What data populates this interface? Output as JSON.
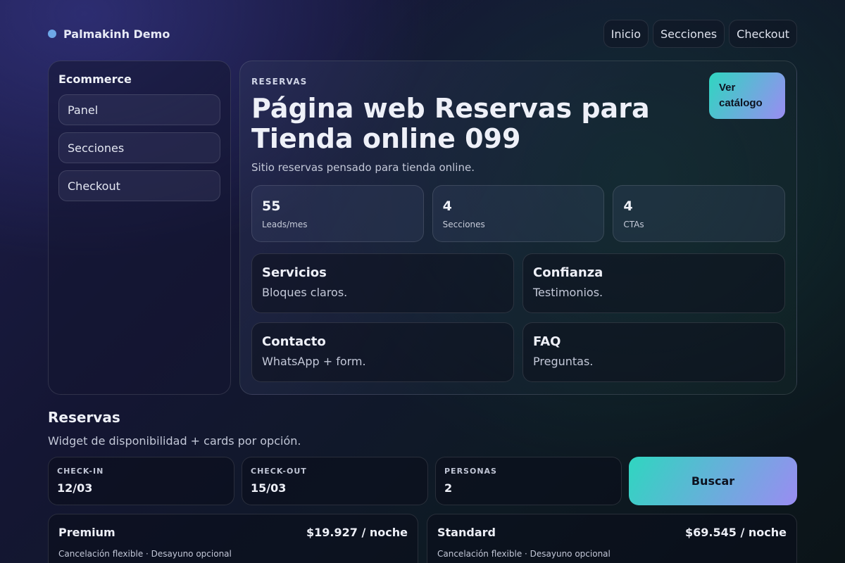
{
  "brand": {
    "name": "Palmakinh Demo",
    "dot_color": "#6ea8e8"
  },
  "topnav": {
    "items": [
      "Inicio",
      "Secciones",
      "Checkout"
    ]
  },
  "sidebar": {
    "title": "Ecommerce",
    "items": [
      "Panel",
      "Secciones",
      "Checkout"
    ]
  },
  "hero": {
    "eyebrow": "RESERVAS",
    "title": "Página web Reservas para Tienda online 099",
    "subtitle": "Sitio reservas pensado para tienda online.",
    "cta_label": "Ver catálogo",
    "stats": [
      {
        "value": "55",
        "label": "Leads/mes"
      },
      {
        "value": "4",
        "label": "Secciones"
      },
      {
        "value": "4",
        "label": "CTAs"
      }
    ],
    "features": [
      {
        "title": "Servicios",
        "desc": "Bloques claros."
      },
      {
        "title": "Confianza",
        "desc": "Testimonios."
      },
      {
        "title": "Contacto",
        "desc": "WhatsApp + form."
      },
      {
        "title": "FAQ",
        "desc": "Preguntas."
      }
    ]
  },
  "reservas": {
    "title": "Reservas",
    "subtitle": "Widget de disponibilidad + cards por opción.",
    "fields": [
      {
        "label": "CHECK-IN",
        "value": "12/03"
      },
      {
        "label": "CHECK-OUT",
        "value": "15/03"
      },
      {
        "label": "PERSONAS",
        "value": "2"
      }
    ],
    "search_label": "Buscar",
    "options": [
      {
        "name": "Premium",
        "price": "$19.927 / noche",
        "note": "Cancelación flexible · Desayuno opcional"
      },
      {
        "name": "Standard",
        "price": "$69.545 / noche",
        "note": "Cancelación flexible · Desayuno opcional"
      }
    ]
  },
  "colors": {
    "accent_start": "#2fd6c0",
    "accent_end": "#9a8cf2"
  }
}
